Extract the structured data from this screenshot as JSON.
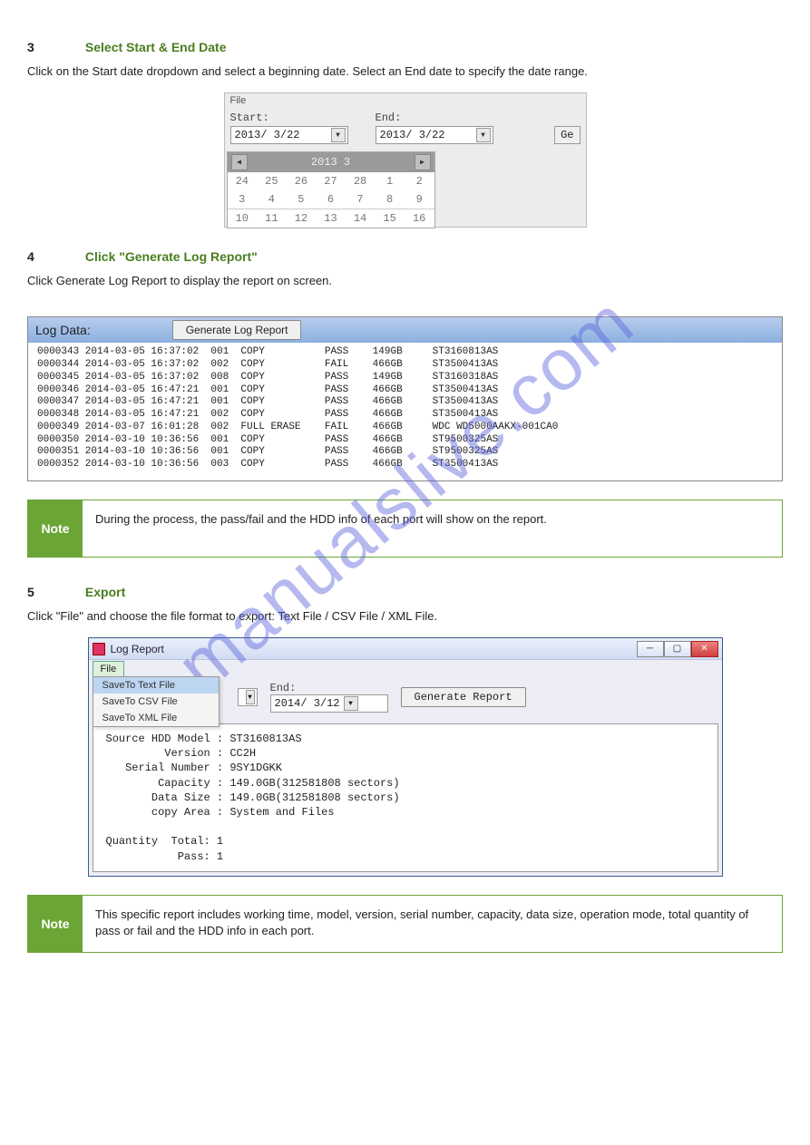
{
  "watermark": "manualslive.com",
  "section1": {
    "num": "3",
    "title": "Select Start & End Date",
    "body": "Click on the Start date dropdown and select a beginning date. Select an End date to specify the date range."
  },
  "fig1": {
    "menu": "File",
    "start_label": "Start:",
    "end_label": "End:",
    "start_value": "2013/ 3/22",
    "end_value": "2013/ 3/22",
    "gen": "Ge",
    "cal_title": "2013   3",
    "cal_rows": [
      [
        "24",
        "25",
        "26",
        "27",
        "28",
        "1",
        "2"
      ],
      [
        "3",
        "4",
        "5",
        "6",
        "7",
        "8",
        "9"
      ],
      [
        "10",
        "11",
        "12",
        "13",
        "14",
        "15",
        "16"
      ]
    ]
  },
  "section2": {
    "num": "4",
    "title": "Click \"Generate Log Report\"",
    "body": "Click Generate Log Report to display the report on screen."
  },
  "logpanel": {
    "label": "Log Data:",
    "button": "Generate Log Report",
    "rows": [
      {
        "id": "0000343",
        "date": "2014-03-05",
        "time": "16:37:02",
        "n": "001",
        "op": "COPY",
        "res": "PASS",
        "cap": "149GB",
        "model": "ST3160813AS"
      },
      {
        "id": "0000344",
        "date": "2014-03-05",
        "time": "16:37:02",
        "n": "002",
        "op": "COPY",
        "res": "FAIL",
        "cap": "466GB",
        "model": "ST3500413AS"
      },
      {
        "id": "0000345",
        "date": "2014-03-05",
        "time": "16:37:02",
        "n": "008",
        "op": "COPY",
        "res": "PASS",
        "cap": "149GB",
        "model": "ST3160318AS"
      },
      {
        "id": "0000346",
        "date": "2014-03-05",
        "time": "16:47:21",
        "n": "001",
        "op": "COPY",
        "res": "PASS",
        "cap": "466GB",
        "model": "ST3500413AS"
      },
      {
        "id": "0000347",
        "date": "2014-03-05",
        "time": "16:47:21",
        "n": "001",
        "op": "COPY",
        "res": "PASS",
        "cap": "466GB",
        "model": "ST3500413AS"
      },
      {
        "id": "0000348",
        "date": "2014-03-05",
        "time": "16:47:21",
        "n": "002",
        "op": "COPY",
        "res": "PASS",
        "cap": "466GB",
        "model": "ST3500413AS"
      },
      {
        "id": "0000349",
        "date": "2014-03-07",
        "time": "16:01:28",
        "n": "002",
        "op": "FULL ERASE",
        "res": "FAIL",
        "cap": "466GB",
        "model": "WDC WD5000AAKX-001CA0"
      },
      {
        "id": "0000350",
        "date": "2014-03-10",
        "time": "10:36:56",
        "n": "001",
        "op": "COPY",
        "res": "PASS",
        "cap": "466GB",
        "model": "ST9500325AS"
      },
      {
        "id": "0000351",
        "date": "2014-03-10",
        "time": "10:36:56",
        "n": "001",
        "op": "COPY",
        "res": "PASS",
        "cap": "466GB",
        "model": "ST9500325AS"
      },
      {
        "id": "0000352",
        "date": "2014-03-10",
        "time": "10:36:56",
        "n": "003",
        "op": "COPY",
        "res": "PASS",
        "cap": "466GB",
        "model": "ST3500413AS"
      }
    ]
  },
  "note1": {
    "tab": "Note",
    "text": "During the process, the pass/fail and the HDD info of each port will show on the report."
  },
  "section3": {
    "num": "5",
    "title": "Export",
    "body": "Click \"File\" and choose the file format to export: Text File / CSV File / XML File."
  },
  "reportwin": {
    "title": "Log Report",
    "file_menu": "File",
    "menu_items": [
      "SaveTo Text File",
      "SaveTo CSV File",
      "SaveTo XML File"
    ],
    "end_label": "End:",
    "arrow_dd": "▼",
    "end_value": "2014/ 3/12",
    "gen_btn": "Generate Report",
    "body_lines": [
      "Source HDD Model : ST3160813AS",
      "         Version : CC2H",
      "   Serial Number : 9SY1DGKK",
      "        Capacity : 149.0GB(312581808 sectors)",
      "       Data Size : 149.0GB(312581808 sectors)",
      "       copy Area : System and Files",
      "",
      "Quantity  Total: 1",
      "           Pass: 1"
    ]
  },
  "note2": {
    "tab": "Note",
    "text": "This specific report includes working time, model, version, serial number, capacity, data size, operation mode, total quantity of pass or fail and the HDD info in each port."
  }
}
